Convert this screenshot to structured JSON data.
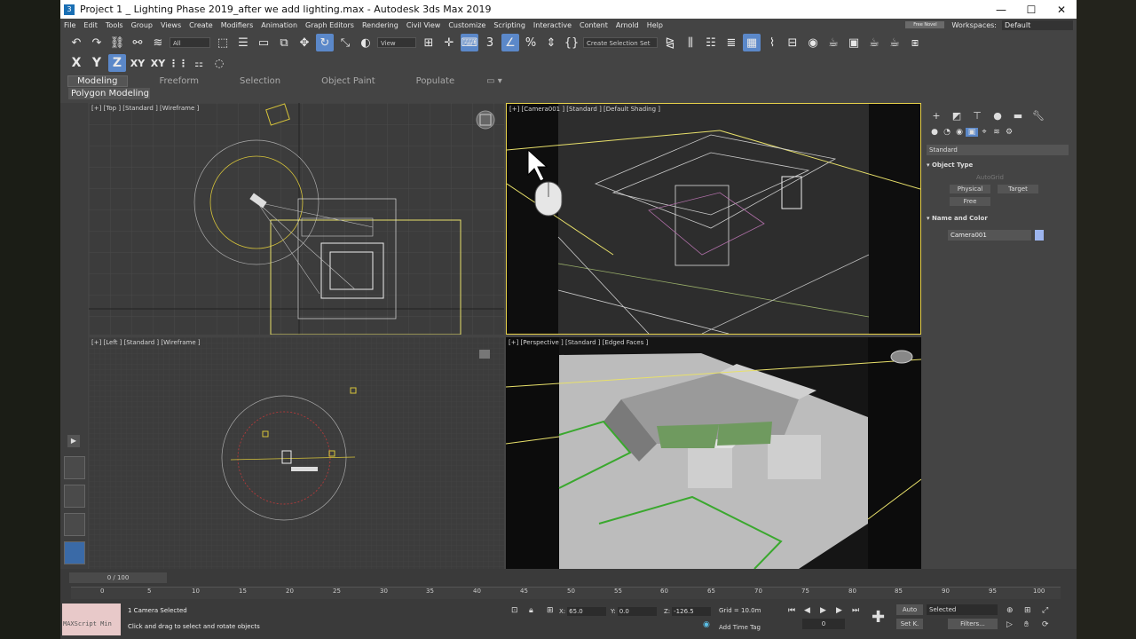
{
  "window": {
    "title": "Project 1 _ Lighting Phase 2019_after we add lighting.max - Autodesk 3ds Max 2019",
    "icon_letter": "3",
    "min": "—",
    "max": "☐",
    "close": "✕"
  },
  "menu": {
    "items": [
      "File",
      "Edit",
      "Tools",
      "Group",
      "Views",
      "Create",
      "Modifiers",
      "Animation",
      "Graph Editors",
      "Rendering",
      "Civil View",
      "Customize",
      "Scripting",
      "Interactive",
      "Content",
      "Arnold",
      "Help"
    ],
    "sign_in": "Free Novel",
    "workspaces_label": "Workspaces:",
    "workspace_value": "Default"
  },
  "toolbar": {
    "filter": "All",
    "view": "View",
    "selection_set": "Create Selection Set",
    "icons": [
      "undo-icon",
      "redo-icon",
      "link-icon",
      "unlink-icon",
      "bind-icon"
    ]
  },
  "axis": {
    "x": "X",
    "y": "Y",
    "z": "Z",
    "xy": "XY",
    "xy2": "XY"
  },
  "ribbon": {
    "tabs": [
      "Modeling",
      "Freeform",
      "Selection",
      "Object Paint",
      "Populate"
    ],
    "sub": "Polygon Modeling"
  },
  "viewports": {
    "top": "[+] [Top ] [Standard ] [Wireframe ]",
    "camera": "[+] [Camera001 ] [Standard ] [Default Shading ]",
    "left": "[+] [Left ] [Standard ] [Wireframe ]",
    "persp": "[+] [Perspective ] [Standard ] [Edged Faces ]"
  },
  "command_panel": {
    "dropdown": "Standard",
    "object_type_title": "Object Type",
    "autogrid": "AutoGrid",
    "physical": "Physical",
    "target": "Target",
    "free": "Free",
    "name_color_title": "Name and Color",
    "name_value": "Camera001",
    "swatch_color": "#9db5ee"
  },
  "timeline": {
    "frame": "0 / 100",
    "ticks": [
      "0",
      "5",
      "10",
      "15",
      "20",
      "25",
      "30",
      "35",
      "40",
      "45",
      "50",
      "55",
      "60",
      "65",
      "70",
      "75",
      "80",
      "85",
      "90",
      "95",
      "100"
    ]
  },
  "status": {
    "maxscript": "MAXScript Min",
    "selected": "1 Camera Selected",
    "prompt": "Click and drag to select and rotate objects",
    "x_label": "X:",
    "x_value": "65.0",
    "y_label": "Y:",
    "y_value": "0.0",
    "z_label": "Z:",
    "z_value": "-126.5",
    "grid": "Grid = 10.0m",
    "add_time_tag": "Add Time Tag",
    "auto": "Auto",
    "setk": "Set K.",
    "selected_dd": "Selected",
    "filters": "Filters...",
    "frame_field": "0"
  }
}
